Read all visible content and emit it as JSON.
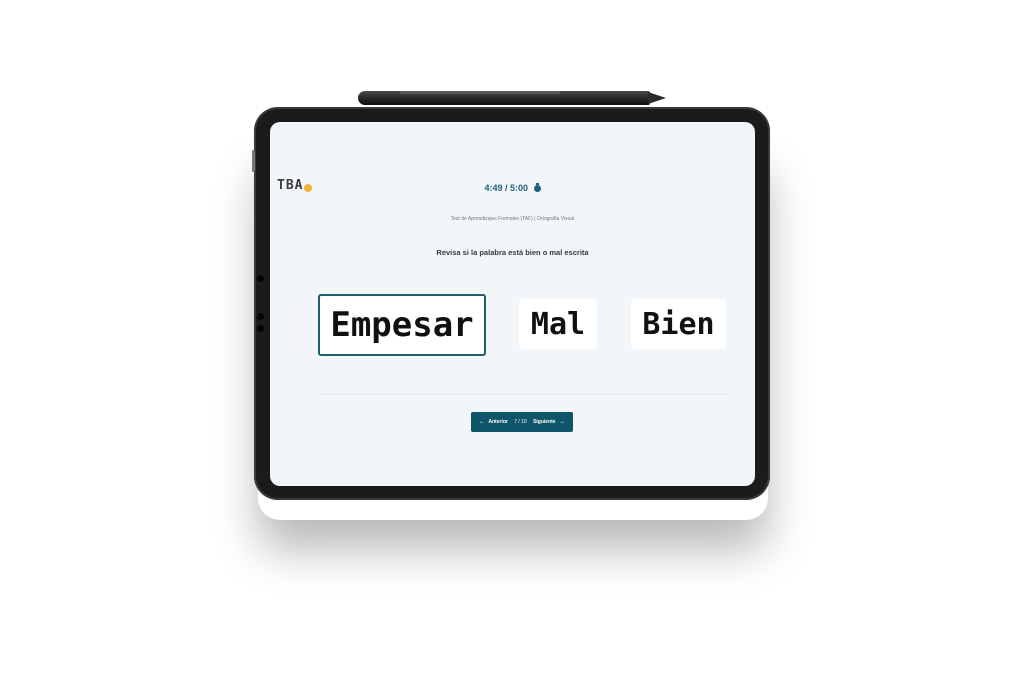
{
  "app": {
    "logo_text": "TBA",
    "timer": "4:49 / 5:00",
    "timer_icon": "stopwatch-icon",
    "subtitle": "Test de Aprendizajes Formales (TAF) | Ortografía Visual",
    "prompt": "Revisa si la palabra está bien o mal escrita"
  },
  "question": {
    "word": "Empesar",
    "options": [
      "Mal",
      "Bien"
    ]
  },
  "navigation": {
    "prev_label": "Anterior",
    "prev_icon": "arrow-left-icon",
    "counter": "7 / 10",
    "next_label": "Siguiente",
    "next_icon": "arrow-right-icon"
  },
  "colors": {
    "accent": "#0f5569",
    "logo_badge": "#f2b233",
    "screen_bg": "#f3f6f9"
  }
}
